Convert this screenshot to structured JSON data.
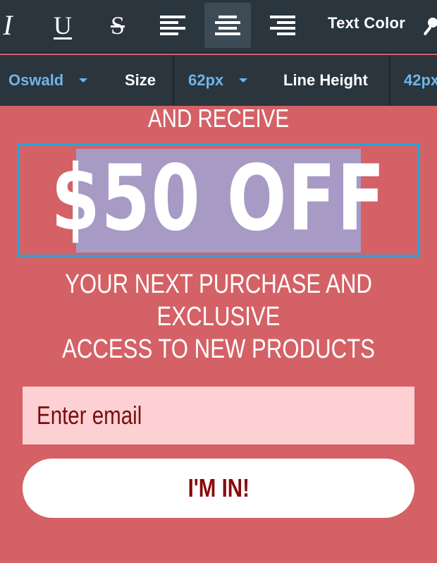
{
  "toolbar": {
    "italic_glyph": "I",
    "underline_glyph": "U",
    "strike_glyph": "S",
    "align_left_icon": "align-left-icon",
    "align_center_icon": "align-center-icon",
    "align_right_icon": "align-right-icon",
    "active_alignment": "center",
    "text_color_label": "Text Color",
    "dropper_icon": "eyedropper-icon"
  },
  "font_bar": {
    "font_family": "Oswald",
    "size_label": "Size",
    "size_value": "62px",
    "line_height_label": "Line Height",
    "line_height_value": "42px"
  },
  "content": {
    "pre_headline": "AND RECEIVE",
    "headline": "$50 OFF",
    "subline_1": "YOUR NEXT PURCHASE AND EXCLUSIVE",
    "subline_2": "ACCESS TO NEW PRODUCTS",
    "email_placeholder": "Enter email",
    "cta_label": "I'M IN!"
  },
  "colors": {
    "background": "#d46166",
    "toolbar": "#2a353e",
    "accent_blue": "#6fb4e8",
    "selection_border": "#1fa8dc",
    "selection_highlight": "#a79ac5",
    "input_bg": "#fdd0d4",
    "cta_text": "#8a0a0a"
  }
}
